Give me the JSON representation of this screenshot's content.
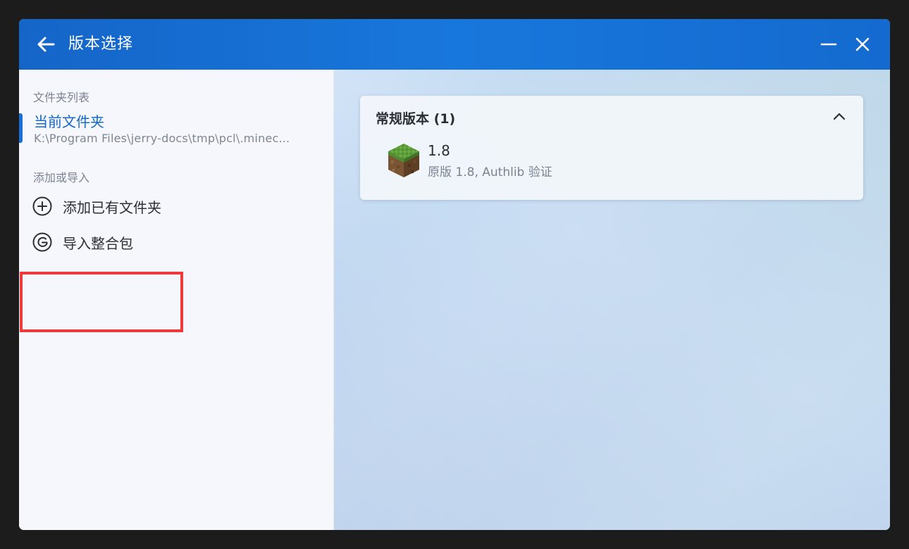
{
  "window": {
    "title": "版本选择",
    "back_icon": "arrow-left-icon",
    "minimize_icon": "minimize-icon",
    "close_icon": "close-icon"
  },
  "sidebar": {
    "folder_list_label": "文件夹列表",
    "current_folder": {
      "name": "当前文件夹",
      "path": "K:\\Program Files\\jerry-docs\\tmp\\pcl\\.minec..."
    },
    "add_or_import_label": "添加或导入",
    "actions": [
      {
        "label": "添加已有文件夹",
        "icon": "plus-circle-icon"
      },
      {
        "label": "导入整合包",
        "icon": "modpack-icon"
      }
    ]
  },
  "main": {
    "group": {
      "title": "常规版本 (1)",
      "expanded": true,
      "versions": [
        {
          "name": "1.8",
          "description": "原版 1.8, Authlib 验证",
          "icon": "grass-block-icon"
        }
      ]
    }
  },
  "colors": {
    "titlebar": "#1877dc",
    "accent": "#1a6fd6",
    "highlight": "#f0393b"
  }
}
